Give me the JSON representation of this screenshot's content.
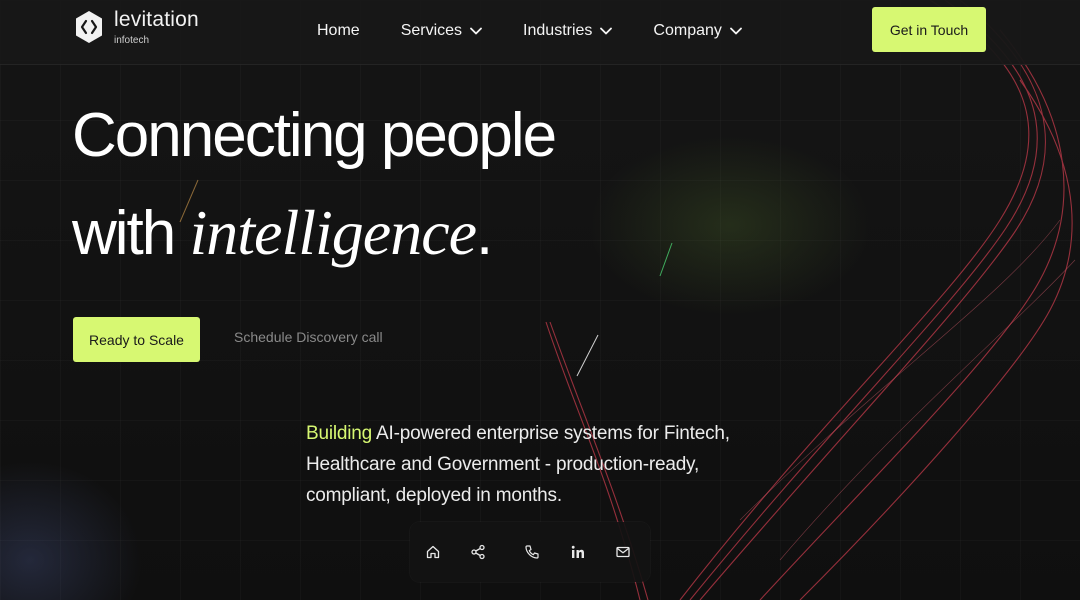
{
  "brand": {
    "name": "levitation",
    "sub": "infotech",
    "logo_icon": "code-brackets-hexagon-icon"
  },
  "nav": {
    "items": [
      {
        "label": "Home",
        "has_dropdown": false
      },
      {
        "label": "Services",
        "has_dropdown": true
      },
      {
        "label": "Industries",
        "has_dropdown": true
      },
      {
        "label": "Company",
        "has_dropdown": true
      }
    ],
    "cta": "Get in Touch"
  },
  "hero": {
    "line1": "Connecting people",
    "line2_prefix": "with ",
    "line2_italic": "intelligence",
    "line2_suffix": "."
  },
  "actions": {
    "primary": "Ready to Scale",
    "secondary": "Schedule Discovery call"
  },
  "description": {
    "accent": "Building",
    "rest": " AI-powered enterprise systems for Fintech, Healthcare and Government - production-ready, compliant, deployed in months."
  },
  "dock": {
    "icons": [
      "home-icon",
      "share-icon",
      "phone-icon",
      "linkedin-icon",
      "mail-icon"
    ]
  },
  "colors": {
    "accent": "#d7f872",
    "background": "#0d0d0d",
    "nav_background": "#181818",
    "decor_red": "#c23a4a"
  }
}
